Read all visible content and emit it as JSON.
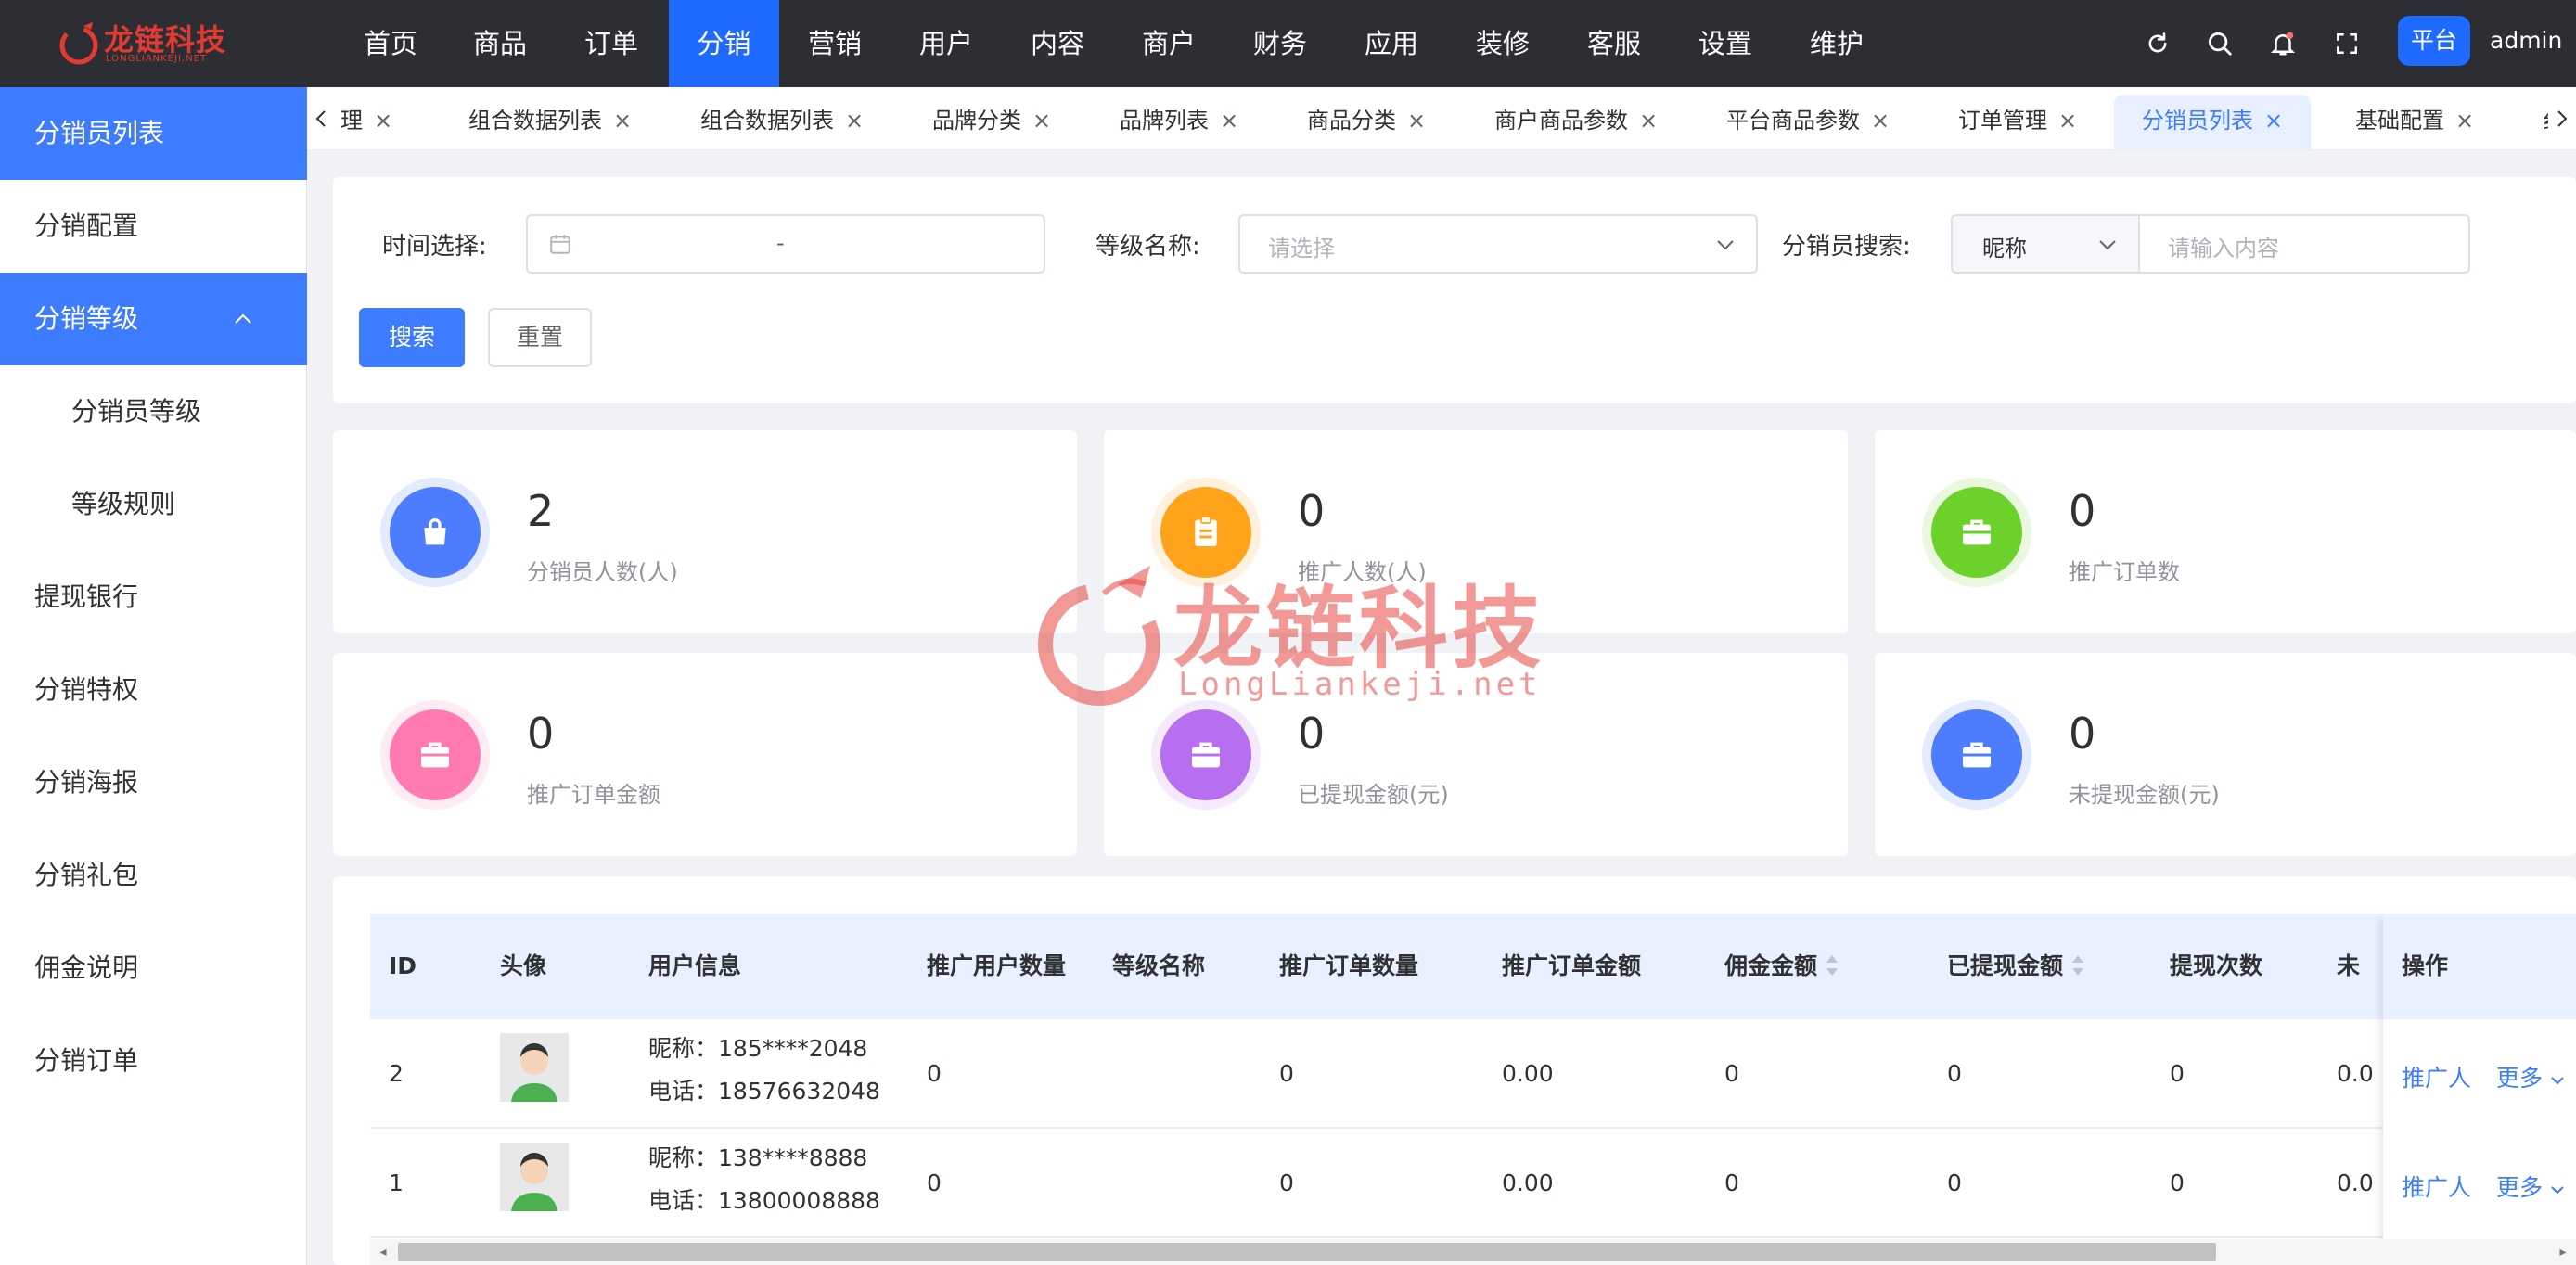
{
  "brand": {
    "logo_name": "龙链科技",
    "logo_sub": "LONGLIANKEJI.NET",
    "accent_color": "#1f6bff"
  },
  "topnav": {
    "items": [
      "首页",
      "商品",
      "订单",
      "分销",
      "营销",
      "用户",
      "内容",
      "商户",
      "财务",
      "应用",
      "装修",
      "客服",
      "设置",
      "维护"
    ],
    "active": "分销",
    "icons": [
      "refresh-icon",
      "search-icon",
      "bell-icon",
      "fullscreen-icon"
    ],
    "platform_badge": "平台",
    "user": "admin"
  },
  "sidebar": {
    "items": [
      {
        "label": "分销员列表",
        "active": true
      },
      {
        "label": "分销配置"
      },
      {
        "label": "分销等级",
        "active": true,
        "expanded": true
      },
      {
        "label": "分销员等级",
        "sub": true
      },
      {
        "label": "等级规则",
        "sub": true
      },
      {
        "label": "提现银行"
      },
      {
        "label": "分销特权"
      },
      {
        "label": "分销海报"
      },
      {
        "label": "分销礼包"
      },
      {
        "label": "佣金说明"
      },
      {
        "label": "分销订单"
      }
    ]
  },
  "tabs": {
    "items": [
      {
        "label": "理"
      },
      {
        "label": "组合数据列表"
      },
      {
        "label": "组合数据列表"
      },
      {
        "label": "品牌分类"
      },
      {
        "label": "品牌列表"
      },
      {
        "label": "商品分类"
      },
      {
        "label": "商户商品参数"
      },
      {
        "label": "平台商品参数"
      },
      {
        "label": "订单管理"
      },
      {
        "label": "分销员列表",
        "active": true
      },
      {
        "label": "基础配置"
      }
    ],
    "close_glyph": "×",
    "partial_tab_glyph": "纟"
  },
  "filters": {
    "time_label": "时间选择:",
    "time_separator": "-",
    "level_label": "等级名称:",
    "level_placeholder": "请选择",
    "search_label": "分销员搜索:",
    "search_type": "昵称",
    "search_placeholder": "请输入内容",
    "search_button": "搜索",
    "reset_button": "重置"
  },
  "stats": [
    {
      "value": "2",
      "label": "分销员人数(人)",
      "color": "#4d7cff",
      "icon": "shopping-bag-icon"
    },
    {
      "value": "0",
      "label": "推广人数(人)",
      "color": "#ffa31a",
      "icon": "clipboard-icon"
    },
    {
      "value": "0",
      "label": "推广订单数",
      "color": "#6dd12b",
      "icon": "briefcase-icon"
    },
    {
      "value": "0",
      "label": "推广订单金额",
      "color": "#ff7ab0",
      "icon": "briefcase-icon"
    },
    {
      "value": "0",
      "label": "已提现金额(元)",
      "color": "#b86ef0",
      "icon": "briefcase-icon"
    },
    {
      "value": "0",
      "label": "未提现金额(元)",
      "color": "#4d7cff",
      "icon": "briefcase-icon"
    }
  ],
  "table": {
    "columns": [
      "ID",
      "头像",
      "用户信息",
      "推广用户数量",
      "等级名称",
      "推广订单数量",
      "推广订单金额",
      "佣金金额",
      "已提现金额",
      "提现次数",
      "未",
      "操作"
    ],
    "rows": [
      {
        "id": "2",
        "nickname": "昵称：185****2048",
        "phone": "电话：18576632048",
        "promo_users": "0",
        "level": "",
        "promo_orders": "0",
        "promo_amount": "0.00",
        "commission": "0",
        "withdrawn": "0",
        "withdraw_count": "0",
        "unwithdrawn": "0.0"
      },
      {
        "id": "1",
        "nickname": "昵称：138****8888",
        "phone": "电话：13800008888",
        "promo_users": "0",
        "level": "",
        "promo_orders": "0",
        "promo_amount": "0.00",
        "commission": "0",
        "withdrawn": "0",
        "withdraw_count": "0",
        "unwithdrawn": "0.0"
      }
    ],
    "action_promoter": "推广人",
    "action_more": "更多"
  },
  "watermark": {
    "text": "龙链科技",
    "sub": "LongLiankeji.net"
  }
}
